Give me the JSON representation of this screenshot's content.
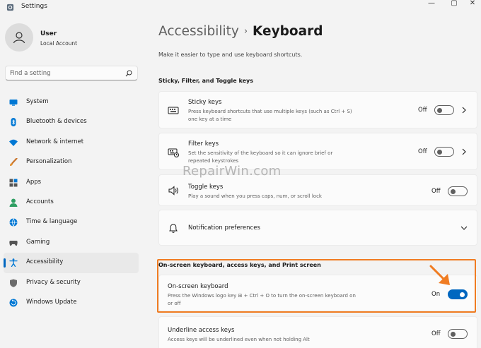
{
  "app": {
    "title": "Settings",
    "minimize": "—",
    "maximize": "▢",
    "close": "✕"
  },
  "user": {
    "name": "User",
    "account_type": "Local Account"
  },
  "search": {
    "placeholder": "Find a setting"
  },
  "sidebar": {
    "items": [
      {
        "label": "System",
        "icon": "system-icon",
        "color": "#0078d4"
      },
      {
        "label": "Bluetooth & devices",
        "icon": "bluetooth-icon",
        "color": "#0078d4"
      },
      {
        "label": "Network & internet",
        "icon": "wifi-icon",
        "color": "#0078d4"
      },
      {
        "label": "Personalization",
        "icon": "brush-icon",
        "color": "#e38f2d"
      },
      {
        "label": "Apps",
        "icon": "apps-icon",
        "color": "#555555"
      },
      {
        "label": "Accounts",
        "icon": "accounts-icon",
        "color": "#2e9e62"
      },
      {
        "label": "Time & language",
        "icon": "globe-icon",
        "color": "#0078d4"
      },
      {
        "label": "Gaming",
        "icon": "gamepad-icon",
        "color": "#555555"
      },
      {
        "label": "Accessibility",
        "icon": "accessibility-icon",
        "color": "#0078d4",
        "selected": true
      },
      {
        "label": "Privacy & security",
        "icon": "shield-icon",
        "color": "#6b6b6b"
      },
      {
        "label": "Windows Update",
        "icon": "update-icon",
        "color": "#0078d4"
      }
    ]
  },
  "breadcrumb": {
    "parent": "Accessibility",
    "separator": "›",
    "current": "Keyboard"
  },
  "page": {
    "subtitle": "Make it easier to type and use keyboard shortcuts."
  },
  "sections": {
    "sticky": {
      "title": "Sticky, Filter, and Toggle keys"
    },
    "onscreen": {
      "title": "On-screen keyboard, access keys, and Print screen"
    }
  },
  "settings": {
    "sticky_keys": {
      "title": "Sticky keys",
      "desc_1": "Press keyboard shortcuts that use multiple keys (such as Ctrl + S)",
      "desc_2": "one key at a time",
      "state": "Off",
      "on": false
    },
    "filter_keys": {
      "title": "Filter keys",
      "desc_1": "Set the sensitivity of the keyboard so it can ignore brief or",
      "desc_2": "repeated keystrokes",
      "state": "Off",
      "on": false
    },
    "toggle_keys": {
      "title": "Toggle keys",
      "desc_1": "Play a sound when you press caps, num, or scroll lock",
      "state": "Off",
      "on": false
    },
    "notification_prefs": {
      "title": "Notification preferences"
    },
    "onscreen_keyboard": {
      "title": "On-screen keyboard",
      "desc_1": "Press the Windows logo key ⊞ + Ctrl + O to turn the on-screen keyboard on",
      "desc_2": "or off",
      "state": "On",
      "on": true
    },
    "underline_access": {
      "title": "Underline access keys",
      "desc_1": "Access keys will be underlined even when not holding Alt",
      "state": "Off",
      "on": false
    }
  },
  "watermark": {
    "text": "RepairWin.com"
  },
  "colors": {
    "accent": "#0067c0",
    "highlight": "#f07c22",
    "background": "#f3f3f3",
    "card": "#fbfbfb"
  }
}
